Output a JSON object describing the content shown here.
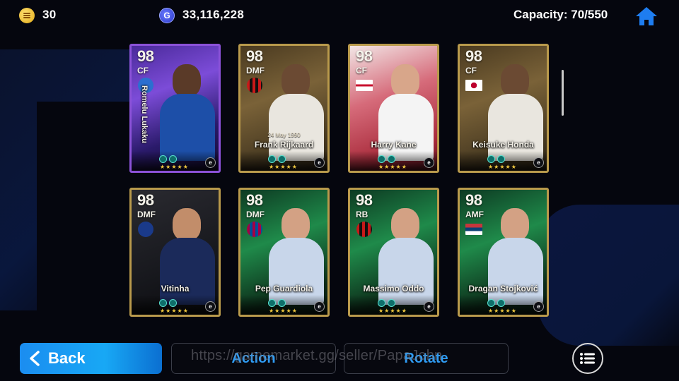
{
  "topbar": {
    "coins": "30",
    "gp": "33,116,228",
    "gp_icon_letter": "G",
    "capacity": "Capacity: 70/550",
    "home_icon": "home-icon",
    "coin_icon": "coin-icon"
  },
  "cards": [
    {
      "rating": "98",
      "position": "CF",
      "name": "Romelu Lukaku",
      "vertical": true,
      "date": "",
      "flag": "club-crest",
      "theme": "purple"
    },
    {
      "rating": "98",
      "position": "DMF",
      "name": "Frank Rijkaard",
      "vertical": false,
      "date": "24 May 1990",
      "flag": "ac-milan-crest",
      "theme": "gold"
    },
    {
      "rating": "98",
      "position": "CF",
      "name": "Harry Kane",
      "vertical": false,
      "date": "",
      "flag": "england-flag",
      "theme": "red"
    },
    {
      "rating": "98",
      "position": "CF",
      "name": "Keisuke Honda",
      "vertical": false,
      "date": "",
      "flag": "japan-flag",
      "theme": "gold"
    },
    {
      "rating": "98",
      "position": "DMF",
      "name": "Vitinha",
      "vertical": false,
      "date": "",
      "flag": "psg-crest",
      "theme": "dark"
    },
    {
      "rating": "98",
      "position": "DMF",
      "name": "Pep Guardiola",
      "vertical": false,
      "date": "",
      "flag": "barcelona-crest",
      "theme": "green"
    },
    {
      "rating": "98",
      "position": "RB",
      "name": "Massimo Oddo",
      "vertical": false,
      "date": "",
      "flag": "ac-milan-crest",
      "theme": "green"
    },
    {
      "rating": "98",
      "position": "AMF",
      "name": "Dragan Stojković",
      "vertical": false,
      "date": "",
      "flag": "serbia-flag",
      "theme": "green"
    }
  ],
  "stars": "★★★★★",
  "efootball_mark": "e",
  "bottom": {
    "back_label": "Back",
    "action_label": "Action",
    "rotate_label": "Rotate",
    "watermark": "https://gamemarket.gg/seller/PapaJohn",
    "menu_icon": "list-menu-icon"
  }
}
